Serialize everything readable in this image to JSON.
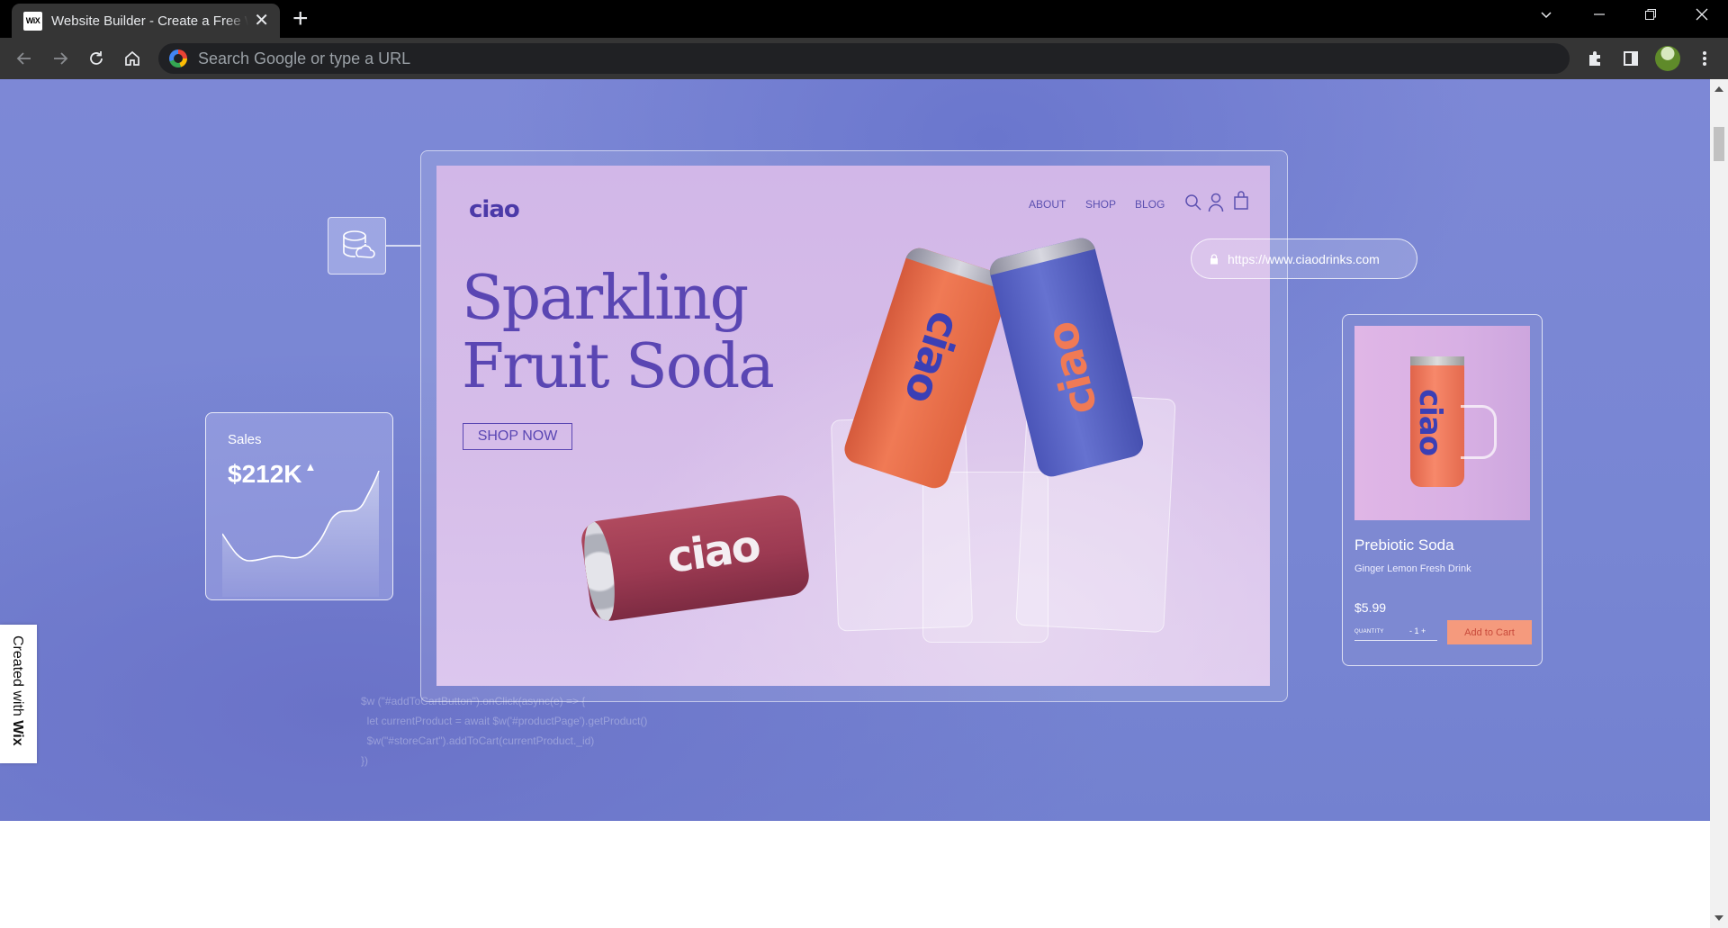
{
  "browser": {
    "tab_title": "Website Builder - Create a Free Website",
    "tab_favicon": "WiX",
    "omnibox_placeholder": "Search Google or type a URL",
    "icons": [
      "back-icon",
      "forward-icon",
      "reload-icon",
      "home-icon",
      "extensions-icon",
      "side-panel-icon",
      "menu-icon"
    ]
  },
  "mock_site": {
    "logo": "ciao",
    "nav": [
      "ABOUT",
      "SHOP",
      "BLOG"
    ],
    "headline_line1": "Sparkling",
    "headline_line2": "Fruit Soda",
    "cta": "SHOP NOW",
    "can_brand": "ciao"
  },
  "url_pill": {
    "url": "https://www.ciaodrinks.com"
  },
  "sales_card": {
    "label": "Sales",
    "value": "$212K"
  },
  "product_card": {
    "name": "Prebiotic Soda",
    "subtitle": "Ginger Lemon Fresh Drink",
    "price": "$5.99",
    "quantity_label": "QUANTITY",
    "quantity": "1",
    "add_to_cart": "Add to Cart"
  },
  "code_snippet": {
    "line1": "$w (\"#addToCartButton\").onClick(async(e) => {",
    "line2": "  let currentProduct = await $w('#productPage').getProduct()",
    "line3": "  $w(\"#storeCart\").addToCart(currentProduct._id)",
    "line4": "})"
  },
  "wix_badge": {
    "prefix": "Created with",
    "brand": "Wix"
  },
  "colors": {
    "hero_bg": "#7886d3",
    "accent_purple": "#5a46b3",
    "cart_button": "#f59a7d"
  }
}
